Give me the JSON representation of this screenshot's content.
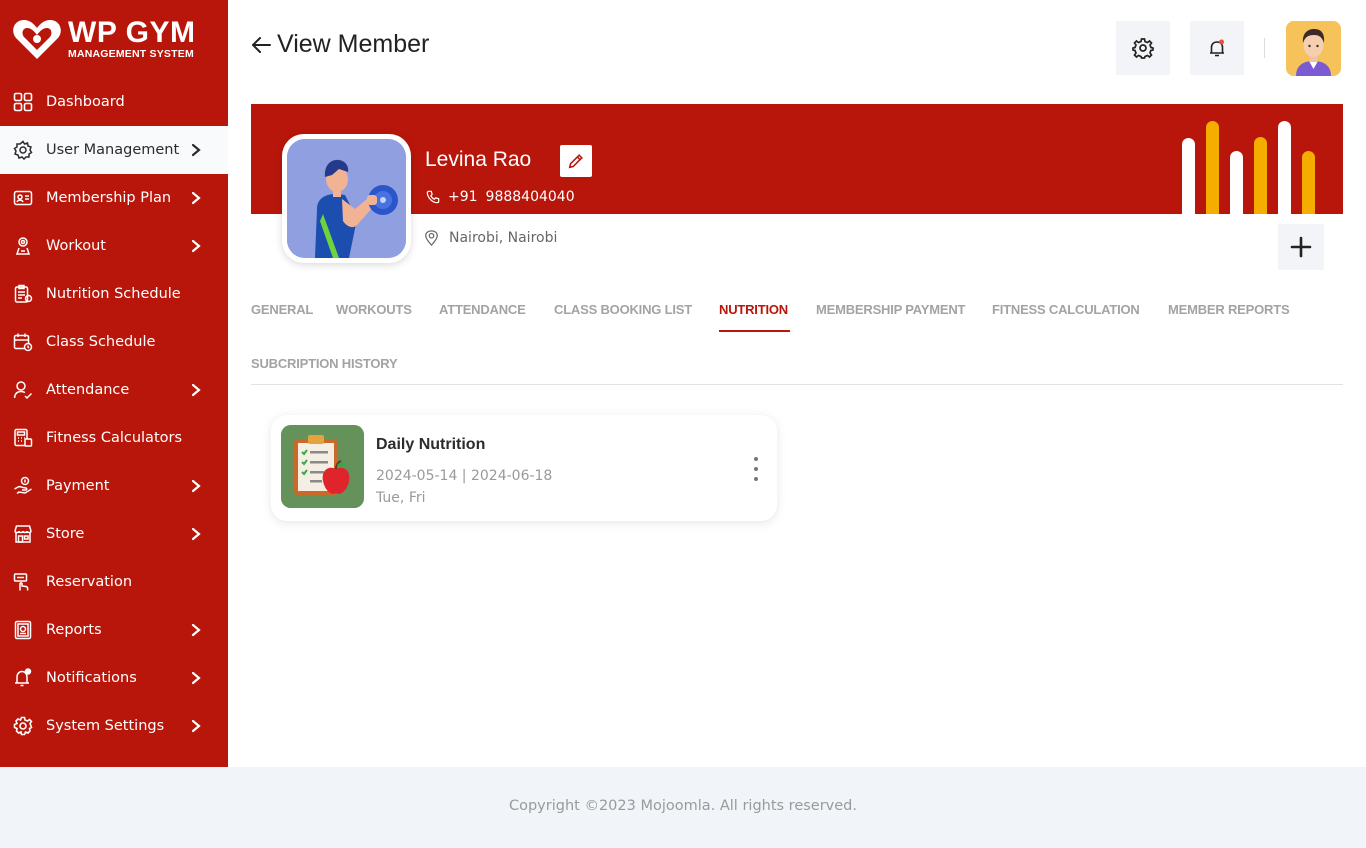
{
  "brand": {
    "title": "WP GYM",
    "subtitle": "MANAGEMENT SYSTEM",
    "color": "#b9160b"
  },
  "sidebar": {
    "items": [
      {
        "label": "Dashboard",
        "icon": "dashboard-icon",
        "chevron": false,
        "active": false
      },
      {
        "label": "User Management",
        "icon": "users-gear-icon",
        "chevron": true,
        "active": true
      },
      {
        "label": "Membership Plan",
        "icon": "membership-card-icon",
        "chevron": true,
        "active": false
      },
      {
        "label": "Workout",
        "icon": "workout-icon",
        "chevron": true,
        "active": false
      },
      {
        "label": "Nutrition Schedule",
        "icon": "nutrition-icon",
        "chevron": false,
        "active": false
      },
      {
        "label": "Class Schedule",
        "icon": "calendar-icon",
        "chevron": false,
        "active": false
      },
      {
        "label": "Attendance",
        "icon": "attendance-icon",
        "chevron": true,
        "active": false
      },
      {
        "label": "Fitness Calculators",
        "icon": "calculator-icon",
        "chevron": false,
        "active": false
      },
      {
        "label": "Payment",
        "icon": "payment-icon",
        "chevron": true,
        "active": false
      },
      {
        "label": "Store",
        "icon": "store-icon",
        "chevron": true,
        "active": false
      },
      {
        "label": "Reservation",
        "icon": "reservation-icon",
        "chevron": false,
        "active": false
      },
      {
        "label": "Reports",
        "icon": "reports-icon",
        "chevron": true,
        "active": false
      },
      {
        "label": "Notifications",
        "icon": "bell-icon",
        "chevron": true,
        "active": false
      },
      {
        "label": "System Settings",
        "icon": "gear-icon",
        "chevron": true,
        "active": false
      }
    ]
  },
  "header": {
    "title": "View Member"
  },
  "member": {
    "name": "Levina Rao",
    "phone_code": "+91",
    "phone": "9888404040",
    "location": "Nairobi, Nairobi"
  },
  "tabs": [
    {
      "label": "GENERAL",
      "active": false
    },
    {
      "label": "WORKOUTS",
      "active": false
    },
    {
      "label": "ATTENDANCE",
      "active": false
    },
    {
      "label": "CLASS BOOKING LIST",
      "active": false
    },
    {
      "label": "NUTRITION",
      "active": true
    },
    {
      "label": "MEMBERSHIP PAYMENT",
      "active": false
    },
    {
      "label": "FITNESS CALCULATION",
      "active": false
    },
    {
      "label": "MEMBER REPORTS",
      "active": false
    },
    {
      "label": "SUBCRIPTION HISTORY",
      "active": false
    }
  ],
  "nutrition_card": {
    "title": "Daily Nutrition",
    "dates": "2024-05-14 | 2024-06-18",
    "days": "Tue, Fri"
  },
  "footer": {
    "copyright": "Copyright ©2023 Mojoomla. All rights reserved."
  }
}
